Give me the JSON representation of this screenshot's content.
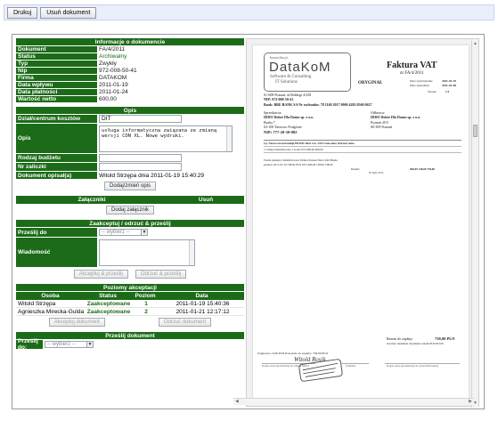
{
  "toolbar": {
    "print_label": "Drukuj",
    "delete_label": "Usuń dokument"
  },
  "info": {
    "title": "Informacje o dokumencie",
    "rows": [
      {
        "label": "Dokument",
        "value": "FA/4/2011"
      },
      {
        "label": "Status",
        "value": "Archiwalny"
      },
      {
        "label": "Typ",
        "value": "Zwykły"
      },
      {
        "label": "Nip",
        "value": "972-008-50-41"
      },
      {
        "label": "Firma",
        "value": "DATAKOM"
      },
      {
        "label": "Data wpływu",
        "value": "2011-01-19"
      },
      {
        "label": "Data płatności",
        "value": "2011-01-24"
      },
      {
        "label": "Wartość netto",
        "value": "600,00"
      }
    ]
  },
  "opis": {
    "title": "Opis",
    "cost_center_label": "Dział/centrum kosztów",
    "cost_center_value": "DIT",
    "desc_label": "Opis",
    "desc_value": "usługa informatyczna związana ze zmianą wersji CDN XL. Nowe wydruki.",
    "budget_label": "Rodzaj budżetu",
    "advance_label": "Nr zaliczki",
    "described_label": "Dokument opisał(a)",
    "described_value": "Witold Strzępa dnia 2011-01-19 15:40:29",
    "add_button": "Dodaj/zmień opis"
  },
  "attachments": {
    "col1": "Załączniki",
    "col2": "Usuń",
    "add_button": "Dodaj załącznik"
  },
  "forward": {
    "title": "Zaakceptuj / odrzuć & prześlij",
    "to_label": "Prześlij do",
    "to_value": "-- wybierz --",
    "msg_label": "Wiadomość",
    "accept_button": "Akceptuj & prześlij",
    "reject_button": "Odrzuć & prześlij"
  },
  "levels": {
    "title": "Poziomy akceptacji",
    "headers": [
      "Osoba",
      "Status",
      "Poziom",
      "Data"
    ],
    "rows": [
      {
        "person": "Witold Strzępa",
        "status": "Zaakceptowane",
        "level": "1",
        "date": "2011-01-19 15:40:36"
      },
      {
        "person": "Agnieszka Mirecka-Gulda",
        "status": "Zaakceptowane",
        "level": "2",
        "date": "2011-01-21 12:17:12"
      }
    ],
    "accept_button": "Akceptuj dokument",
    "reject_button": "Odrzuć dokument"
  },
  "send": {
    "title": "Prześlij dokument",
    "to_label": "Prześlij do:",
    "to_value": "-- wybierz --"
  },
  "pdf": {
    "logo_top": "konsultacje",
    "logo_main": "DataKoM",
    "logo_sub1": "Software & Consulting",
    "logo_sub2": "IT Solutions",
    "addr1": "61-608 Poznań, ul.Bołdogi 4/258",
    "addr2": "NIP: 972-008-50-41",
    "bank": "Bank: BRE BANK SA   Nr rachunku: 78 1140 2017 0000 4202 0560 0627",
    "doc_title": "Faktura VAT",
    "doc_no": "nr FA/4/2011",
    "original": "ORYGINAŁ",
    "date_issue_label": "Data wystawienia:",
    "date_issue": "2011-01-19",
    "date_sale_label": "Data sprzedaży:",
    "date_sale": "2011-01-06",
    "page_label": "Strona:",
    "page": "1/1",
    "seller_label": "Sprzedawca:",
    "seller_name": "IDDO Dobre Dla Domu sp. z o.o.",
    "seller_addr1": "Bruka 7",
    "seller_addr2": "63-100 Tarnowo Podgórne",
    "seller_nip": "NIP: 777-20-30-082",
    "buyer_label": "Odbiorca:",
    "buyer_name": "IDDO Dobre Dla Domu sp. z o.o.",
    "buyer_addr1": "Poznań 45/5",
    "buyer_addr2": "60-309 Poznań",
    "table_head": "Lp.  Nazwa towaru/usługi                         PKWiU        Ilość  J.m.   VAT   Cena netto  Wartość netto",
    "table_row": "1    Usługa informatyczna                                      1    Godz   22%     600,00       600,00",
    "pay_head": "Forma płatności   Termin       Kwota Waluta     Stawka        Netto        VAT       Brutto",
    "pay_row": "przelew           2011-01-24   738,00  PLN      22%          600,00      138,00     738,00",
    "sum_label": "Razem:",
    "sum_row": "600,00      138,00      738,00",
    "vat_row": "W tym: 22%",
    "due_label": "Razem do zapłaty:",
    "due_value": "738,00 PLN",
    "words": "słownie: siedemset trzydzieści osiem PLN 00/100",
    "paid_line": "Zapłacono: 0,00 PLN   Pozostało do zapłaty: 738,00 PLN",
    "sig_left": "Podpis osoby upoważnionej do odbioru faktury",
    "sig_right": "Podpis osoby upoważnionej do wystawienia faktury",
    "sig_mid": "Tytuł/data",
    "signature": "Witold Rosik"
  }
}
